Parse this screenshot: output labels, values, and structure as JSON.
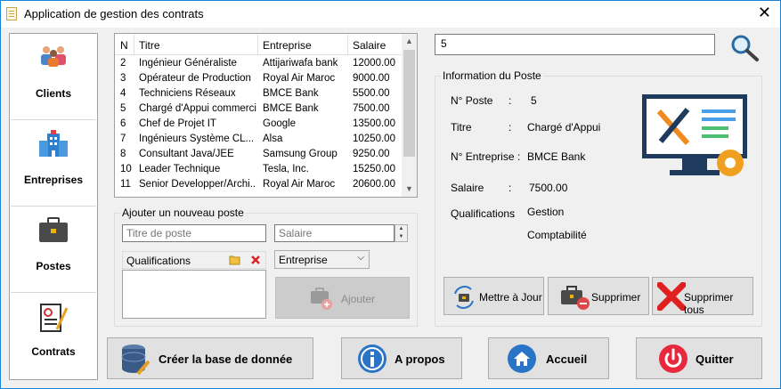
{
  "window": {
    "title": "Application de gestion des contrats",
    "close_glyph": "✕"
  },
  "nav": {
    "items": [
      {
        "label": "Clients",
        "icon": "clients-icon"
      },
      {
        "label": "Entreprises",
        "icon": "building-icon"
      },
      {
        "label": "Postes",
        "icon": "briefcase-icon"
      },
      {
        "label": "Contrats",
        "icon": "contract-icon"
      }
    ]
  },
  "table": {
    "headers": [
      "N",
      "Titre",
      "Entreprise",
      "Salaire"
    ],
    "rows": [
      [
        "2",
        "Ingénieur Généraliste",
        "Attijariwafa bank",
        "12000.00"
      ],
      [
        "3",
        "Opérateur de Production",
        "Royal Air Maroc",
        "9000.00"
      ],
      [
        "4",
        "Techniciens Réseaux",
        "BMCE Bank",
        "5500.00"
      ],
      [
        "5",
        "Chargé d'Appui commercial",
        "BMCE Bank",
        "7500.00"
      ],
      [
        "6",
        "Chef de Projet IT",
        "Google",
        "13500.00"
      ],
      [
        "7",
        "Ingénieurs Système CL...",
        "Alsa",
        "10250.00"
      ],
      [
        "8",
        "Consultant Java/JEE",
        "Samsung Group",
        "9250.00"
      ],
      [
        "10",
        "Leader Technique",
        "Tesla, Inc.",
        "15250.00"
      ],
      [
        "11",
        "Senior Developper/Archi...",
        "Royal Air Maroc",
        "20600.00"
      ]
    ]
  },
  "add_group": {
    "title": "Ajouter un nouveau poste",
    "titre_placeholder": "Titre de poste",
    "salaire_placeholder": "Salaire",
    "qualifications_label": "Qualifications",
    "entreprise_select": "Entreprise",
    "add_button": "Ajouter"
  },
  "search": {
    "value": "5"
  },
  "info": {
    "title": "Information du Poste",
    "fields": [
      {
        "label": "N° Poste",
        "sep": ":",
        "value": "5"
      },
      {
        "label": "Titre",
        "sep": ":",
        "value": "Chargé d'Appui"
      },
      {
        "label": "N° Entreprise",
        "sep": ":",
        "value": "BMCE Bank"
      },
      {
        "label": "Salaire",
        "sep": ":",
        "value": "7500.00"
      },
      {
        "label": "Qualifications",
        "sep": ":",
        "value": "Gestion"
      }
    ],
    "qualification_extra": "Comptabilité",
    "buttons": {
      "update": "Mettre à Jour",
      "delete": "Supprimer",
      "delete_all": "Supprimer tous"
    }
  },
  "bottom": {
    "create_db": "Créer la base de donnée",
    "about": "A propos",
    "home": "Accueil",
    "quit": "Quitter"
  },
  "colors": {
    "accent": "#1883d7",
    "quit_red": "#e8283c",
    "info_blue": "#2a74c8"
  }
}
